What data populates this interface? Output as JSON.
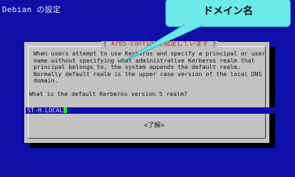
{
  "window": {
    "title": "Debian の設定"
  },
  "dialog": {
    "title": "krb5-config を設定しています",
    "description_lines": [
      "When users attempt to use Kerberos and specify a principal or user",
      "name without specifying what administrative Kerberos realm that",
      "principal belongs to, the system appends the default realm.",
      "Normally default realm is the upper case version of the local DNS",
      "domain."
    ],
    "question": "What is the default Kerberos version 5 realm?",
    "realm_value": "ST-H.LOCAL",
    "ok_label": "<了解>"
  },
  "callout": {
    "label": "ドメイン名"
  },
  "colors": {
    "terminal_background": "#0d0fa8",
    "dialog_background": "#c2c2c2",
    "dialog_title_text": "#b8201a",
    "input_background": "#0d0fa8",
    "cursor": "#21ee33",
    "callout_fill": "#6ee9e9",
    "callout_border": "#3aa5b8"
  }
}
